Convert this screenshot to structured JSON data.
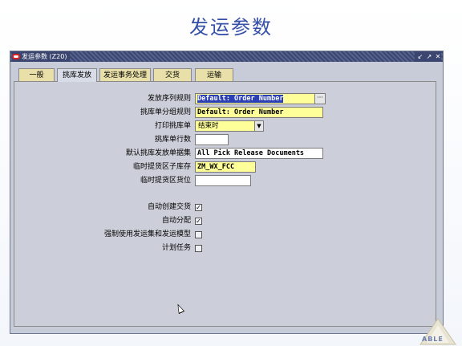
{
  "slide": {
    "title": "发运参数"
  },
  "window": {
    "title": "发运参数  (Z20)",
    "controls": [
      "minimize-icon",
      "maximize-icon",
      "close-icon"
    ]
  },
  "tabs": [
    {
      "label": "一般",
      "active": false
    },
    {
      "label": "挑库发放",
      "active": true
    },
    {
      "label": "发运事务处理",
      "active": false
    },
    {
      "label": "交货",
      "active": false
    },
    {
      "label": "运输",
      "active": false
    }
  ],
  "form": {
    "release_seq_rule": {
      "label": "发放序列规则",
      "value": "Default: Order Number"
    },
    "pick_slip_grouping": {
      "label": "挑库单分组规则",
      "value": "Default: Order Number"
    },
    "print_pick_slip": {
      "label": "打印挑库单",
      "value": "结束时"
    },
    "pick_slip_lines": {
      "label": "挑库单行数",
      "value": ""
    },
    "default_doc_set": {
      "label": "默认挑库发放单据集",
      "value": "All Pick Release Documents"
    },
    "staging_subinv": {
      "label": "临时提货区子库存",
      "value": "ZM_WX_FCC"
    },
    "staging_locator": {
      "label": "临时提货区货位",
      "value": ""
    },
    "auto_create_delivery": {
      "label": "自动创建交货",
      "checked": true
    },
    "auto_allocate": {
      "label": "自动分配",
      "checked": true
    },
    "enforce_ship_sets": {
      "label": "强制使用发运集和发运模型",
      "checked": false
    },
    "plan_tasks": {
      "label": "计划任务",
      "checked": false
    }
  },
  "logo": {
    "text": "ABLE"
  },
  "colors": {
    "field_required": "#ffff99",
    "selection": "#2b3fb7",
    "title": "#3550a8"
  }
}
